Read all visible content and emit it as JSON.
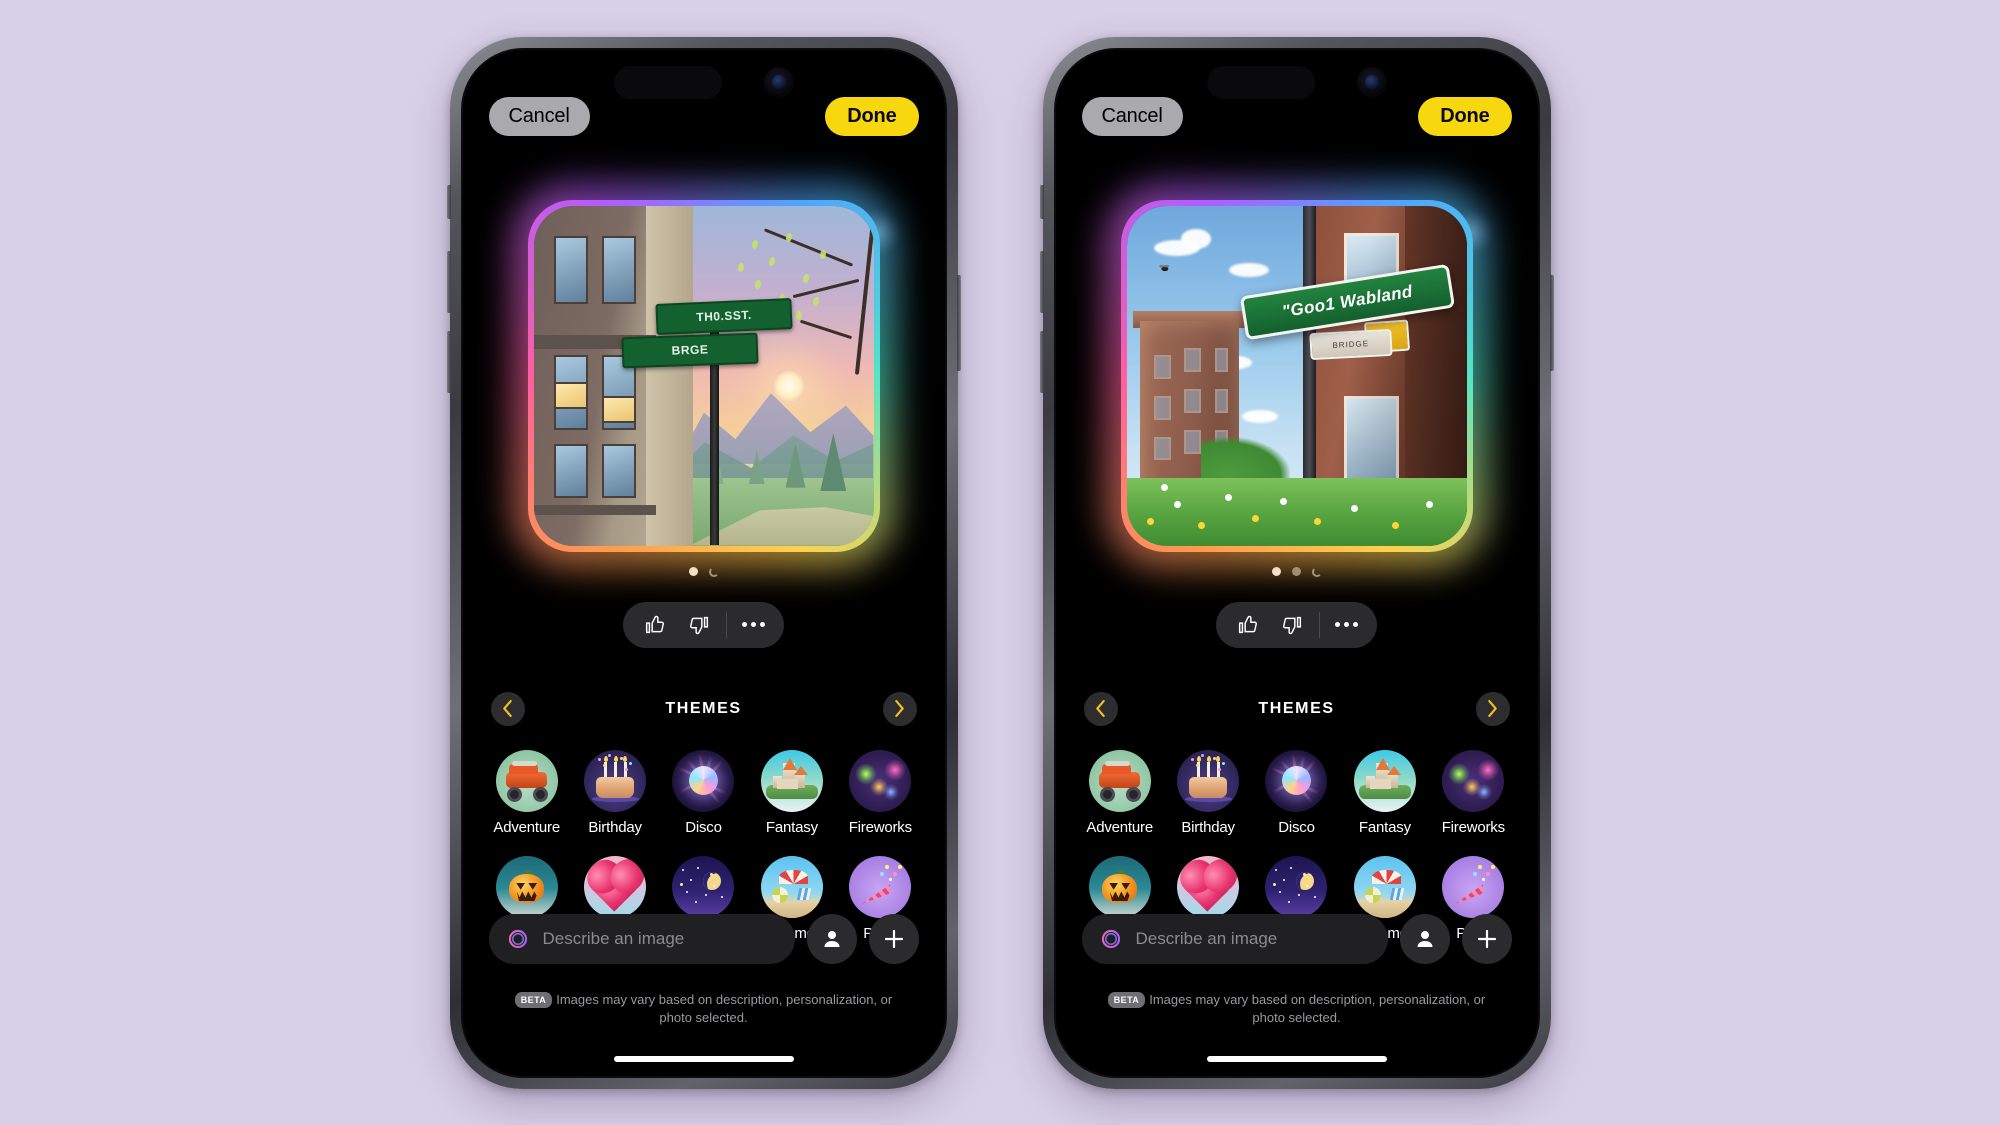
{
  "background_color": "#d8d0e6",
  "accent": {
    "done_yellow": "#f7d80f",
    "cancel_gray": "#a9a9ae",
    "nav_chevron": "#f0c01e"
  },
  "phones": [
    {
      "id": "phone-left",
      "topbar": {
        "cancel_label": "Cancel",
        "done_label": "Done"
      },
      "preview": {
        "alt": "Dusk city building beside sunset mountain landscape with green street signs",
        "sign_top_text": "TH0.SST.",
        "sign_bottom_text": "BRGE"
      },
      "page_dots": [
        {
          "state": "active"
        },
        {
          "state": "loading"
        }
      ],
      "feedback": {
        "thumbs_up": "thumbs-up",
        "thumbs_down": "thumbs-down",
        "more": "more-options"
      },
      "themes": {
        "title": "THEMES",
        "prev_label": "‹",
        "next_label": "›",
        "items": [
          {
            "label": "Adventure",
            "icon": "adventure-jeep-icon"
          },
          {
            "label": "Birthday",
            "icon": "birthday-cake-icon"
          },
          {
            "label": "Disco",
            "icon": "disco-ball-icon"
          },
          {
            "label": "Fantasy",
            "icon": "fantasy-castle-icon"
          },
          {
            "label": "Fireworks",
            "icon": "fireworks-icon"
          },
          {
            "label": "Halloween",
            "icon": "halloween-pumpkin-icon"
          },
          {
            "label": "Love",
            "icon": "love-heart-icon"
          },
          {
            "label": "Starry Night",
            "icon": "starry-night-icon"
          },
          {
            "label": "Summer",
            "icon": "summer-beach-icon"
          },
          {
            "label": "Party",
            "icon": "party-popper-icon"
          }
        ]
      },
      "prompt": {
        "placeholder": "Describe an image",
        "value": "",
        "person_button": "person-icon",
        "add_button": "plus-icon"
      },
      "disclaimer": {
        "badge": "BETA",
        "text": "Images may vary based on description, personalization, or photo selected."
      }
    },
    {
      "id": "phone-right",
      "topbar": {
        "cancel_label": "Cancel",
        "done_label": "Done"
      },
      "preview": {
        "alt": "Sunlit brick buildings with green street sign over a wildflower meadow",
        "sign_main_text": "\"Goo1 Wabland",
        "sign_small_text": "BRIDGE"
      },
      "page_dots": [
        {
          "state": "active"
        },
        {
          "state": "inactive"
        },
        {
          "state": "loading"
        }
      ],
      "feedback": {
        "thumbs_up": "thumbs-up",
        "thumbs_down": "thumbs-down",
        "more": "more-options"
      },
      "themes": {
        "title": "THEMES",
        "prev_label": "‹",
        "next_label": "›",
        "items": [
          {
            "label": "Adventure",
            "icon": "adventure-jeep-icon"
          },
          {
            "label": "Birthday",
            "icon": "birthday-cake-icon"
          },
          {
            "label": "Disco",
            "icon": "disco-ball-icon"
          },
          {
            "label": "Fantasy",
            "icon": "fantasy-castle-icon"
          },
          {
            "label": "Fireworks",
            "icon": "fireworks-icon"
          },
          {
            "label": "Halloween",
            "icon": "halloween-pumpkin-icon"
          },
          {
            "label": "Love",
            "icon": "love-heart-icon"
          },
          {
            "label": "Starry Night",
            "icon": "starry-night-icon"
          },
          {
            "label": "Summer",
            "icon": "summer-beach-icon"
          },
          {
            "label": "Party",
            "icon": "party-popper-icon"
          }
        ]
      },
      "prompt": {
        "placeholder": "Describe an image",
        "value": "",
        "person_button": "person-icon",
        "add_button": "plus-icon"
      },
      "disclaimer": {
        "badge": "BETA",
        "text": "Images may vary based on description, personalization, or photo selected."
      }
    }
  ]
}
